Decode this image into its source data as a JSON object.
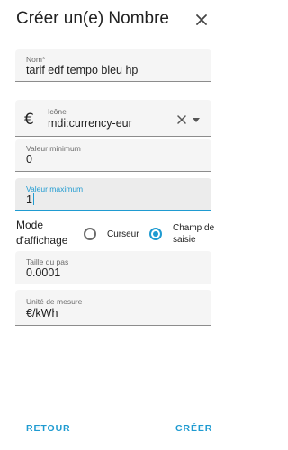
{
  "dialog": {
    "title": "Créer un(e) Nombre"
  },
  "fields": {
    "name": {
      "label": "Nom*",
      "value": "tarif edf tempo bleu hp"
    },
    "icon": {
      "label": "Icône",
      "value": "mdi:currency-eur",
      "symbol": "€"
    },
    "min": {
      "label": "Valeur minimum",
      "value": "0"
    },
    "max": {
      "label": "Valeur maximum",
      "value": "1"
    },
    "step": {
      "label": "Taille du pas",
      "value": "0.0001"
    },
    "unit": {
      "label": "Unité de mesure",
      "value": "€/kWh"
    }
  },
  "display_mode": {
    "label": "Mode d'affichage",
    "options": [
      {
        "label": "Curseur",
        "selected": false
      },
      {
        "label": "Champ de saisie",
        "selected": true
      }
    ]
  },
  "footer": {
    "back_label": "RETOUR",
    "create_label": "CRÉER"
  },
  "colors": {
    "accent": "#1f9bd1",
    "field_bg": "#f5f5f5",
    "text": "#212121"
  }
}
